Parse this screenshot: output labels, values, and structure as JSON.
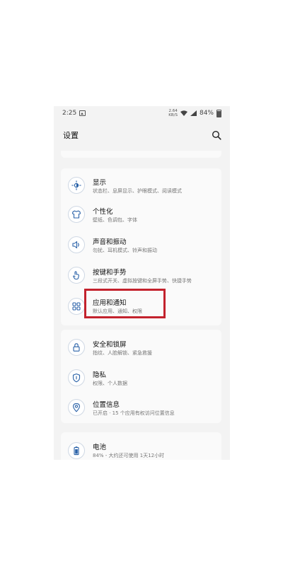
{
  "status_bar": {
    "time": "2:25",
    "network_speed_value": "2.64",
    "network_speed_unit": "KB/S",
    "battery": "84%"
  },
  "header": {
    "title": "设置"
  },
  "sections": [
    {
      "items": [
        {
          "title": "显示",
          "subtitle": "状态栏、息屏显示、护眼模式、阅读模式",
          "icon": "brightness-icon"
        },
        {
          "title": "个性化",
          "subtitle": "壁纸、色调包、字体",
          "icon": "tshirt-icon"
        },
        {
          "title": "声音和振动",
          "subtitle": "勿扰、耳机模式、铃声和振动",
          "icon": "speaker-icon"
        },
        {
          "title": "按键和手势",
          "subtitle": "三段式开关、虚拟按键和全屏手势、快捷手势",
          "icon": "gesture-icon"
        },
        {
          "title": "应用和通知",
          "subtitle": "默认应用、通知、权限",
          "icon": "apps-icon",
          "highlighted": true
        }
      ]
    },
    {
      "items": [
        {
          "title": "安全和锁屏",
          "subtitle": "指纹、人脸解锁、紧急救援",
          "icon": "lock-icon"
        },
        {
          "title": "隐私",
          "subtitle": "权限、个人数据",
          "icon": "shield-icon"
        },
        {
          "title": "位置信息",
          "subtitle": "已开启 · 15 个应用有权访问位置信息",
          "icon": "location-icon"
        }
      ]
    },
    {
      "items": [
        {
          "title": "电池",
          "subtitle": "84% - 大约还可使用 1天12小时",
          "icon": "battery-icon"
        }
      ]
    }
  ],
  "colors": {
    "icon_blue": "#2a62a8",
    "highlight_red": "#c3222d"
  }
}
